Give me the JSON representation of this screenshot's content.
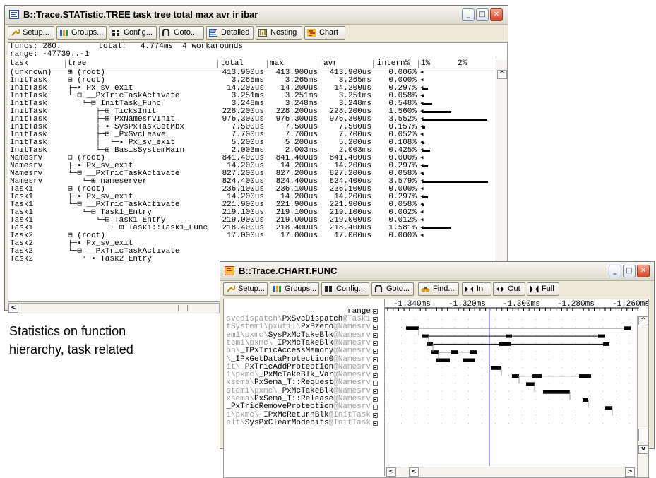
{
  "stat_window": {
    "title": "B::Trace.STATistic.TREE task tree total max avr ir ibar",
    "toolbar": [
      {
        "label": "Setup...",
        "icon": "wrench-icon"
      },
      {
        "label": "Groups...",
        "icon": "groups-icon"
      },
      {
        "label": "Config...",
        "icon": "config-icon"
      },
      {
        "label": "Goto...",
        "icon": "goto-icon"
      },
      {
        "label": "Detailed",
        "icon": "detailed-icon"
      },
      {
        "label": "Nesting",
        "icon": "nesting-icon"
      },
      {
        "label": "Chart",
        "icon": "chart-icon"
      }
    ],
    "summary_line1": "funcs: 280.        total:   4.774ms  4 workarounds",
    "summary_line2": "range: -47739..-1",
    "columns": [
      "task",
      "tree",
      "total",
      "max",
      "avr",
      "intern%",
      "1%",
      "2%"
    ],
    "rows": [
      {
        "task": "(unknown)",
        "tree": "⊞ (root)",
        "total": "413.900us",
        "max": "413.900us",
        "avr": "413.900us",
        "intern": "0.006%",
        "bar_pct": 0.006
      },
      {
        "task": "InitTask",
        "tree": "⊟ (root)",
        "total": "3.265ms",
        "max": "3.265ms",
        "avr": "3.265ms",
        "intern": "0.000%",
        "bar_pct": 0
      },
      {
        "task": "InitTask",
        "tree": "├─▪ Px_sv_exit",
        "total": "14.200us",
        "max": "14.200us",
        "avr": "14.200us",
        "intern": "0.297%",
        "bar_pct": 0.297
      },
      {
        "task": "InitTask",
        "tree": "└─⊟ __PxTricTaskActivate",
        "total": "3.251ms",
        "max": "3.251ms",
        "avr": "3.251ms",
        "intern": "0.058%",
        "bar_pct": 0.058
      },
      {
        "task": "InitTask",
        "tree": "   └─⊟ InitTask_Func",
        "total": "3.248ms",
        "max": "3.248ms",
        "avr": "3.248ms",
        "intern": "0.548%",
        "bar_pct": 0.548
      },
      {
        "task": "InitTask",
        "tree": "      ├─⊞ TicksInit",
        "total": "228.200us",
        "max": "228.200us",
        "avr": "228.200us",
        "intern": "1.560%",
        "bar_pct": 1.56
      },
      {
        "task": "InitTask",
        "tree": "      ├─⊞ PxNamesrvInit",
        "total": "976.300us",
        "max": "976.300us",
        "avr": "976.300us",
        "intern": "3.552%",
        "bar_pct": 3.552
      },
      {
        "task": "InitTask",
        "tree": "      ├─▪ SysPxTaskGetMbx",
        "total": "7.500us",
        "max": "7.500us",
        "avr": "7.500us",
        "intern": "0.157%",
        "bar_pct": 0.157
      },
      {
        "task": "InitTask",
        "tree": "      ├─⊟ _PxSvcLeave",
        "total": "7.700us",
        "max": "7.700us",
        "avr": "7.700us",
        "intern": "0.052%",
        "bar_pct": 0.052
      },
      {
        "task": "InitTask",
        "tree": "      │  └─▪ Px_sv_exit",
        "total": "5.200us",
        "max": "5.200us",
        "avr": "5.200us",
        "intern": "0.108%",
        "bar_pct": 0.108
      },
      {
        "task": "InitTask",
        "tree": "      └─⊞ BasisSystemMain",
        "total": "2.003ms",
        "max": "2.003ms",
        "avr": "2.003ms",
        "intern": "0.425%",
        "bar_pct": 0.425
      },
      {
        "task": "Namesrv",
        "tree": "⊟ (root)",
        "total": "841.400us",
        "max": "841.400us",
        "avr": "841.400us",
        "intern": "0.000%",
        "bar_pct": 0
      },
      {
        "task": "Namesrv",
        "tree": "├─▪ Px_sv_exit",
        "total": "14.200us",
        "max": "14.200us",
        "avr": "14.200us",
        "intern": "0.297%",
        "bar_pct": 0.297
      },
      {
        "task": "Namesrv",
        "tree": "└─⊟ __PxTricTaskActivate",
        "total": "827.200us",
        "max": "827.200us",
        "avr": "827.200us",
        "intern": "0.058%",
        "bar_pct": 0.058
      },
      {
        "task": "Namesrv",
        "tree": "   └─⊞ nameserver",
        "total": "824.400us",
        "max": "824.400us",
        "avr": "824.400us",
        "intern": "3.579%",
        "bar_pct": 3.579
      },
      {
        "task": "Task1",
        "tree": "⊟ (root)",
        "total": "236.100us",
        "max": "236.100us",
        "avr": "236.100us",
        "intern": "0.000%",
        "bar_pct": 0
      },
      {
        "task": "Task1",
        "tree": "├─▪ Px_sv_exit",
        "total": "14.200us",
        "max": "14.200us",
        "avr": "14.200us",
        "intern": "0.297%",
        "bar_pct": 0.297
      },
      {
        "task": "Task1",
        "tree": "└─⊟ __PxTricTaskActivate",
        "total": "221.900us",
        "max": "221.900us",
        "avr": "221.900us",
        "intern": "0.058%",
        "bar_pct": 0.058
      },
      {
        "task": "Task1",
        "tree": "   └─⊟ Task1_Entry",
        "total": "219.100us",
        "max": "219.100us",
        "avr": "219.100us",
        "intern": "0.002%",
        "bar_pct": 0.002
      },
      {
        "task": "Task1",
        "tree": "      └─⊟ Task1_Entry",
        "total": "219.000us",
        "max": "219.000us",
        "avr": "219.000us",
        "intern": "0.012%",
        "bar_pct": 0.012
      },
      {
        "task": "Task1",
        "tree": "         └─⊞ Task1::Task1_Func",
        "total": "218.400us",
        "max": "218.400us",
        "avr": "218.400us",
        "intern": "1.581%",
        "bar_pct": 1.581
      },
      {
        "task": "Task2",
        "tree": "⊟ (root)",
        "total": "17.000us",
        "max": "17.000us",
        "avr": "17.000us",
        "intern": "0.000%",
        "bar_pct": 0
      },
      {
        "task": "Task2",
        "tree": "├─▪ Px_sv_exit",
        "total": "",
        "max": "",
        "avr": "",
        "intern": "",
        "bar_pct": 0
      },
      {
        "task": "Task2",
        "tree": "└─⊟ __PxTricTaskActivate",
        "total": "",
        "max": "",
        "avr": "",
        "intern": "",
        "bar_pct": 0
      },
      {
        "task": "Task2",
        "tree": "   └─▪ Task2_Entry",
        "total": "",
        "max": "",
        "avr": "",
        "intern": "",
        "bar_pct": 0
      }
    ]
  },
  "caption": {
    "line1": "Statistics on function",
    "line2": "hierarchy, task related"
  },
  "chart_window": {
    "title": "B::Trace.CHART.FUNC",
    "toolbar": [
      {
        "label": "Setup...",
        "icon": "wrench-icon"
      },
      {
        "label": "Groups...",
        "icon": "groups-icon"
      },
      {
        "label": "Config...",
        "icon": "config-icon"
      },
      {
        "label": "Goto...",
        "icon": "goto-icon"
      },
      {
        "label": "Find...",
        "icon": "binoculars-icon"
      },
      {
        "label": "In",
        "icon": "zoom-in-icon"
      },
      {
        "label": "Out",
        "icon": "zoom-out-icon"
      },
      {
        "label": "Full",
        "icon": "full-icon"
      }
    ],
    "range_label": "range",
    "time_ticks": [
      "-1.340ms",
      "-1.320ms",
      "-1.300ms",
      "-1.280ms",
      "-1.260ms"
    ],
    "functions": [
      {
        "pre": "svcdispatch\\",
        "name": "PxSvcDispatch",
        "suf": "@Task1"
      },
      {
        "pre": "tSystem1\\pxutil\\",
        "name": "PxBzero",
        "suf": "@Namesrv"
      },
      {
        "pre": "em1\\pxmc\\",
        "name": "SysPxMcTakeBlk",
        "suf": "@Namesrv"
      },
      {
        "pre": "tem1\\pxmc\\",
        "name": "_IPxMcTakeBlk",
        "suf": "@Namesrv"
      },
      {
        "pre": "on\\",
        "name": "_IPxTricAccessMemory",
        "suf": "@Namesrv"
      },
      {
        "pre": "\\",
        "name": "_IPxGetDataProtection0",
        "suf": "@Namesrv"
      },
      {
        "pre": "it\\",
        "name": "_PxTricAddProtection",
        "suf": "@Namesrv"
      },
      {
        "pre": "1\\pxmc\\",
        "name": "_PxMcTakeBlk_Var",
        "suf": "@Namesrv"
      },
      {
        "pre": "xsema\\",
        "name": "PxSema_T::Request",
        "suf": "@Namesrv"
      },
      {
        "pre": "stem1\\pxmc\\",
        "name": "_PxMcTakeBlk",
        "suf": "@Namesrv"
      },
      {
        "pre": "xsema\\",
        "name": "PxSema_T::Release",
        "suf": "@Namesrv"
      },
      {
        "pre": "",
        "name": "_PxTricRemoveProtection",
        "suf": "@Namesrv"
      },
      {
        "pre": "1\\pxmc\\",
        "name": "_IPxMcReturnBlk",
        "suf": "@InitTask"
      },
      {
        "pre": "elf\\",
        "name": "SysPxClearModebits",
        "suf": "@InitTask"
      }
    ]
  }
}
